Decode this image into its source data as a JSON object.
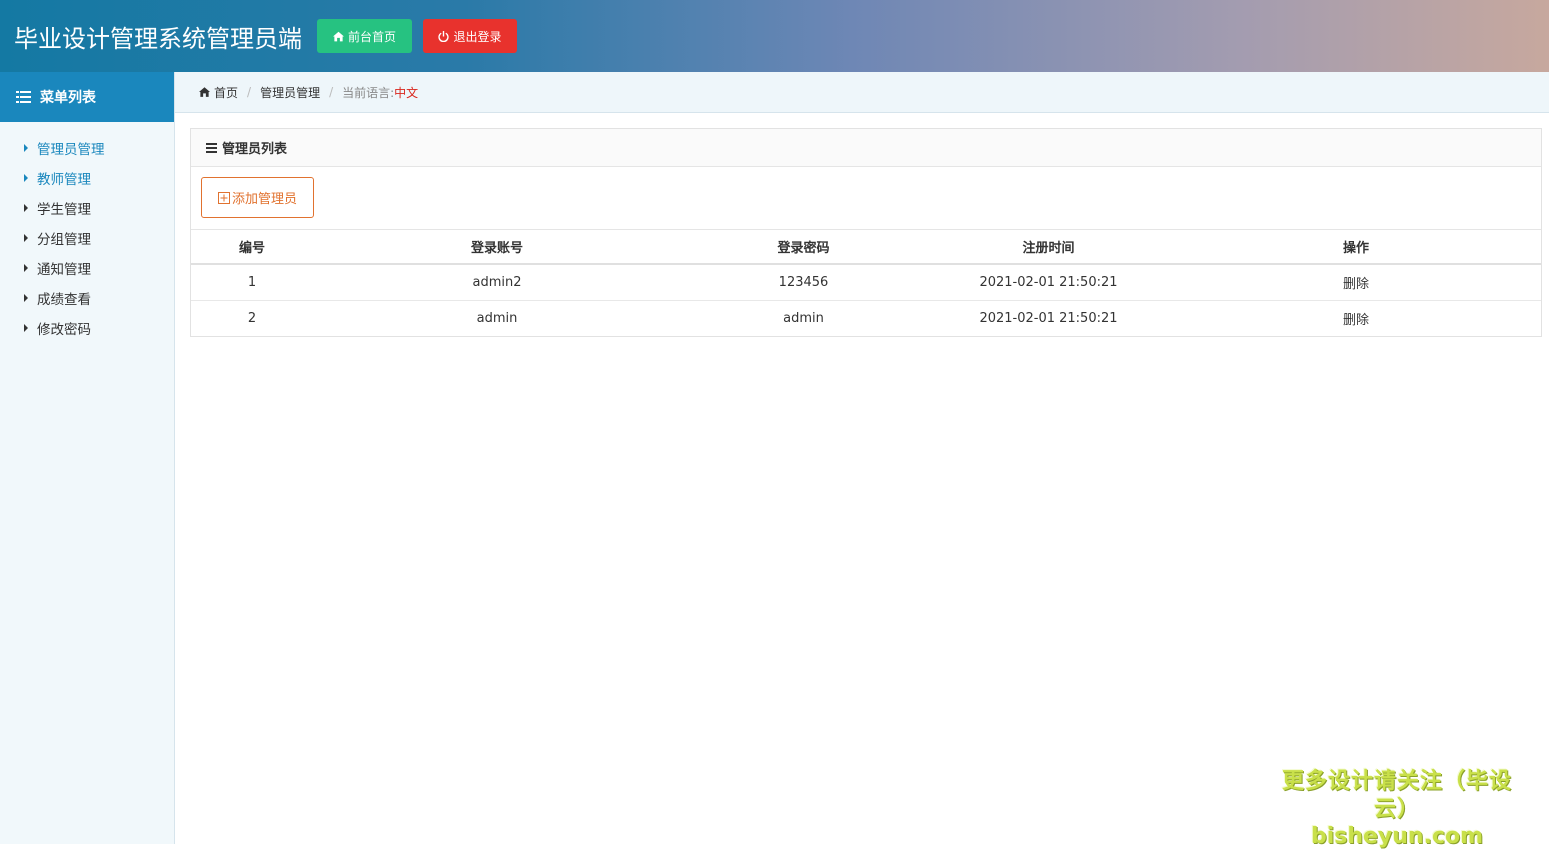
{
  "header": {
    "title": "毕业设计管理系统管理员端",
    "home_button": "前台首页",
    "logout_button": "退出登录",
    "colors": {
      "home": "#26c281",
      "logout": "#e8322d"
    }
  },
  "sidebar": {
    "heading": "菜单列表",
    "items": [
      {
        "label": "管理员管理",
        "active": true
      },
      {
        "label": "教师管理",
        "active": true
      },
      {
        "label": "学生管理",
        "active": false
      },
      {
        "label": "分组管理",
        "active": false
      },
      {
        "label": "通知管理",
        "active": false
      },
      {
        "label": "成绩查看",
        "active": false
      },
      {
        "label": "修改密码",
        "active": false
      }
    ]
  },
  "breadcrumb": {
    "home": "首页",
    "current": "管理员管理",
    "lang_label": "当前语言:",
    "lang_value": "中文"
  },
  "panel": {
    "title": "管理员列表",
    "add_button": "添加管理员",
    "columns": [
      "编号",
      "登录账号",
      "登录密码",
      "注册时间",
      "操作"
    ],
    "rows": [
      {
        "id": "1",
        "account": "admin2",
        "password": "123456",
        "registered": "2021-02-01 21:50:21",
        "action": "删除"
      },
      {
        "id": "2",
        "account": "admin",
        "password": "admin",
        "registered": "2021-02-01 21:50:21",
        "action": "删除"
      }
    ]
  },
  "watermark": {
    "line1": "更多设计请关注（毕设云）",
    "line2": "bisheyun.com"
  }
}
